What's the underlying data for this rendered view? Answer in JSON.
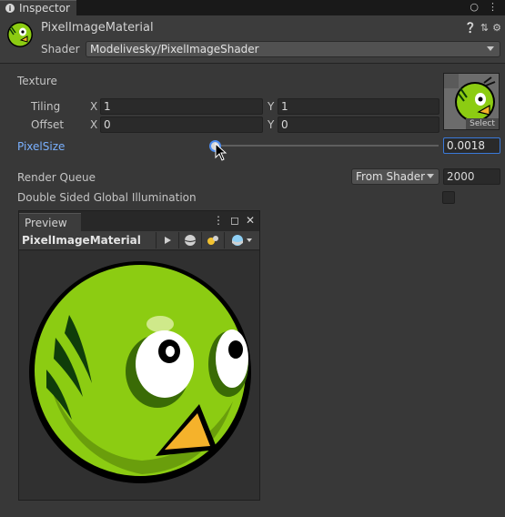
{
  "window": {
    "tab_label": "Inspector",
    "tab_icon": "info-icon",
    "menu_icons": [
      "lock-icon",
      "kebab-menu-icon"
    ]
  },
  "header": {
    "material_name": "PixelImageMaterial",
    "shader_label": "Shader",
    "shader_value": "Modelivesky/PixelImageShader",
    "icons": [
      "help-icon",
      "preset-icon",
      "settings-gear-icon"
    ]
  },
  "properties": {
    "texture": {
      "label": "Texture",
      "select_label": "Select",
      "tiling_label": "Tiling",
      "offset_label": "Offset",
      "x_label": "X",
      "y_label": "Y",
      "tiling_x": "1",
      "tiling_y": "1",
      "offset_x": "0",
      "offset_y": "0"
    },
    "pixel_size": {
      "label": "PixelSize",
      "value": "0.0018",
      "slider_fraction": 0.0
    },
    "render_queue": {
      "label": "Render Queue",
      "mode": "From Shader",
      "value": "2000"
    },
    "double_sided_gi": {
      "label": "Double Sided Global Illumination",
      "checked": false
    }
  },
  "preview": {
    "tab_label": "Preview",
    "title": "PixelImageMaterial",
    "toolbar_icons": [
      "play-icon",
      "sphere-mesh-icon",
      "lights-icon",
      "background-sphere-icon"
    ]
  },
  "colors": {
    "accent_blue": "#4d8df0",
    "bird_green": "#8ccc12",
    "beak_orange": "#f5b22b"
  }
}
